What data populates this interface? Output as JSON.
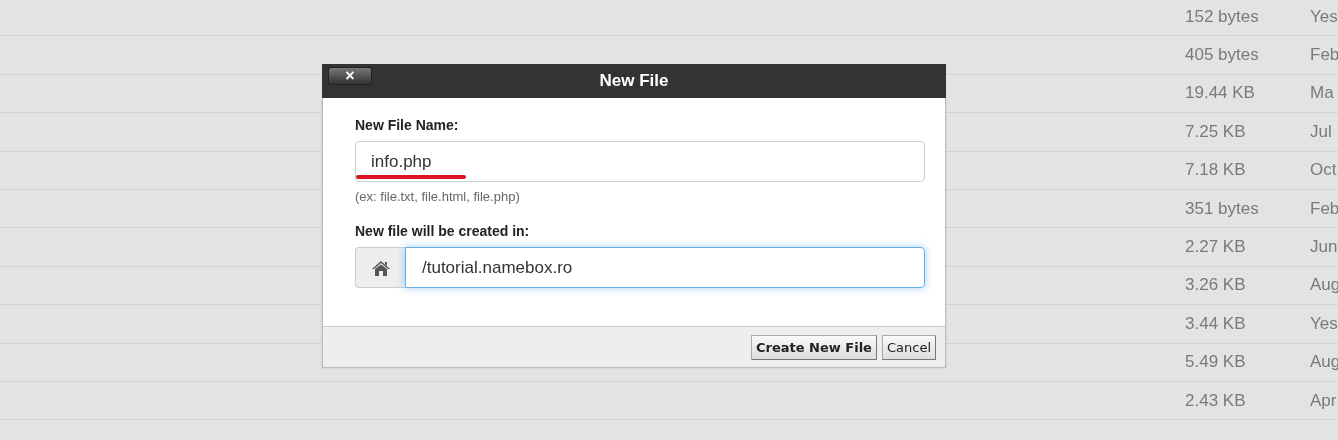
{
  "file_list": {
    "rows": [
      {
        "column_2": "152 bytes",
        "column_3": "Yes"
      },
      {
        "column_2": "405 bytes",
        "column_3": "Feb"
      },
      {
        "column_2": "19.44 KB",
        "column_3": "Ma"
      },
      {
        "column_2": "7.25 KB",
        "column_3": "Jul"
      },
      {
        "column_2": "7.18 KB",
        "column_3": "Oct"
      },
      {
        "column_2": "351 bytes",
        "column_3": "Feb"
      },
      {
        "column_2": "2.27 KB",
        "column_3": "Jun"
      },
      {
        "column_2": "3.26 KB",
        "column_3": "Aug"
      },
      {
        "column_2": "3.44 KB",
        "column_3": "Yes"
      },
      {
        "column_2": "5.49 KB",
        "column_3": "Aug"
      },
      {
        "column_2": "2.43 KB",
        "column_3": "Apr"
      }
    ]
  },
  "dialog": {
    "title": "New File",
    "close": "×",
    "name_field": {
      "label": "New File Name:",
      "value": "info.php",
      "underlined": true,
      "hint": "(ex: file.txt, file.html, file.php)"
    },
    "path_field": {
      "label": "New file will be created in:",
      "value": "/tutorial.namebox.ro",
      "focused": true
    },
    "buttons": [
      "Create New File",
      "Cancel"
    ]
  }
}
